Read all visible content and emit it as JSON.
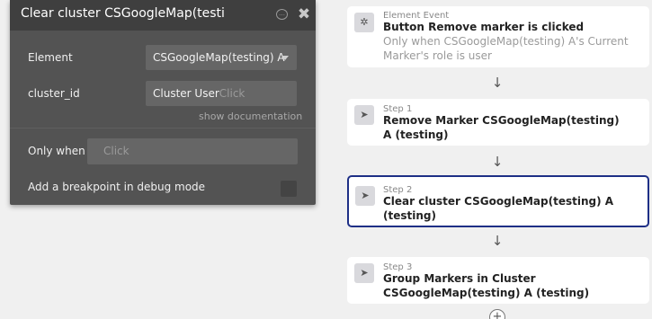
{
  "panel": {
    "title": "Clear cluster CSGoogleMap(testi",
    "element_label": "Element",
    "element_value": "CSGoogleMap(testing) A",
    "cluster_label": "cluster_id",
    "cluster_value": "Cluster User",
    "cluster_placeholder": "Click",
    "show_documentation": "show documentation",
    "only_when_label": "Only when",
    "only_when_placeholder": "Click",
    "breakpoint_label": "Add a breakpoint in debug mode",
    "icons": {
      "chat": "comment-icon",
      "close": "close-icon",
      "dropdown": "chevron-down-icon"
    }
  },
  "workflow": {
    "event": {
      "kicker": "Element Event",
      "title": "Button Remove marker is clicked",
      "condition": "Only when CSGoogleMap(testing) A's Current Marker's role is user",
      "icon": "cursor-click-icon"
    },
    "steps": [
      {
        "kicker": "Step 1",
        "title": "Remove Marker CSGoogleMap(testing) A (testing)",
        "icon": "pointer-icon"
      },
      {
        "kicker": "Step 2",
        "title": "Clear cluster CSGoogleMap(testing) A (testing)",
        "icon": "pointer-icon",
        "selected": true
      },
      {
        "kicker": "Step 3",
        "title": "Group Markers in Cluster CSGoogleMap(testing) A (testing)",
        "icon": "pointer-icon"
      }
    ],
    "arrow_glyph": "↓",
    "add_glyph": "+"
  },
  "colors": {
    "panel_bg": "#535353",
    "panel_header": "#3f3f3f",
    "field_bg": "#666666",
    "selected_border": "#1e2f86",
    "canvas_bg": "#f0f0f0"
  }
}
